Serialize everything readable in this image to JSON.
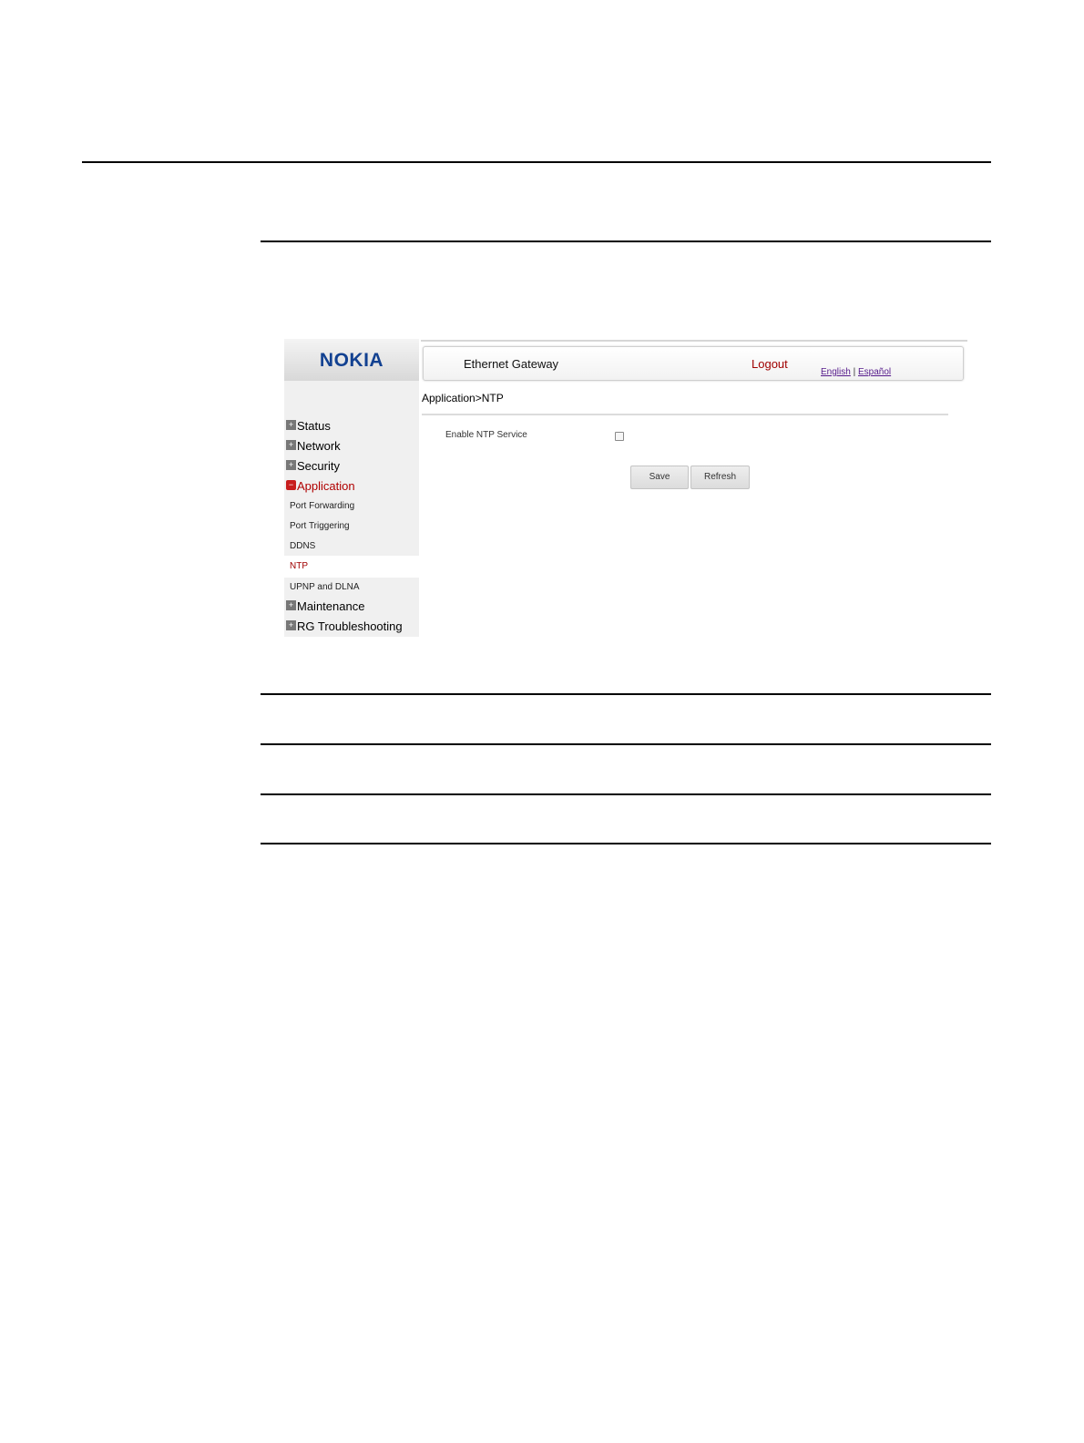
{
  "brand": {
    "logo_text": "NOKIA",
    "logo_color": "#124191"
  },
  "header": {
    "title": "Ethernet Gateway",
    "logout_label": "Logout",
    "lang_english": "English",
    "lang_separator": "|",
    "lang_espanol": "Español"
  },
  "sidebar": {
    "sections": [
      {
        "label": "Status",
        "expanded": false
      },
      {
        "label": "Network",
        "expanded": false
      },
      {
        "label": "Security",
        "expanded": false
      },
      {
        "label": "Application",
        "expanded": true
      },
      {
        "label": "Maintenance",
        "expanded": false
      },
      {
        "label": "RG Troubleshooting",
        "expanded": false
      }
    ],
    "application_items": [
      {
        "label": "Port Forwarding"
      },
      {
        "label": "Port Triggering"
      },
      {
        "label": "DDNS"
      },
      {
        "label": "NTP",
        "selected": true
      },
      {
        "label": "UPNP and DLNA"
      }
    ],
    "expand_icon_glyph": "+",
    "collapse_icon_glyph": "−"
  },
  "main": {
    "breadcrumb": "Application>NTP",
    "enable_ntp_label": "Enable NTP Service",
    "enable_ntp_checked": false,
    "save_label": "Save",
    "refresh_label": "Refresh"
  },
  "colors": {
    "active": "#b00000",
    "link": "#551a8b"
  }
}
